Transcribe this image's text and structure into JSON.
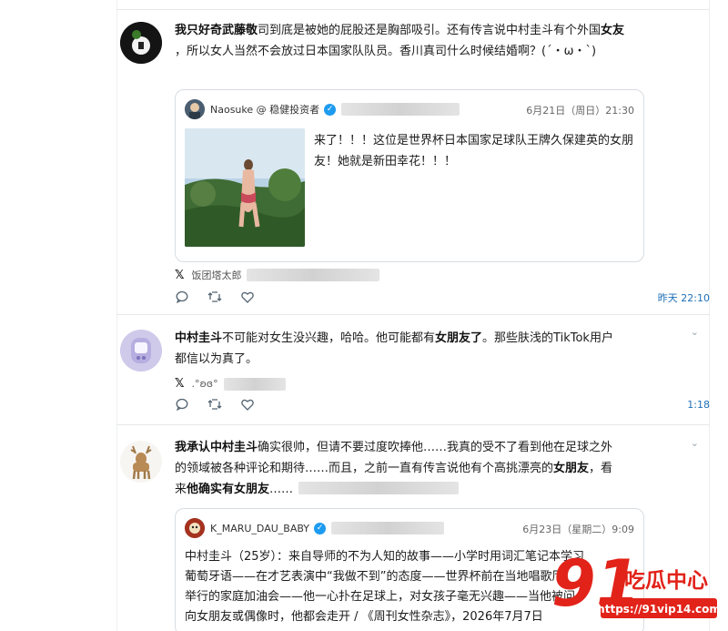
{
  "posts": [
    {
      "author": "我只好奇武藤敬",
      "text_before": "司到底是被她的屁股还是胸部吸引。还有传言说中村圭斗有个外国",
      "bold_tail": "女友",
      "line2": "，所以女人当然不会放过日本国家队队员。香川真司什么时候结婚啊？(´・ω・`)",
      "quote": {
        "author": "Naosuke @ 稳健投资者",
        "date": "6月21日（周日）21:30",
        "text": "来了！！！这位是世界杯日本国家足球队王牌久保建英的女朋友！她就是新田幸花！！！"
      },
      "source_name": "饭团塔太郎",
      "time": "昨天 22:10"
    },
    {
      "author": "中村圭斗",
      "text_a": "不可能对女生没兴趣，哈哈。他可能都有",
      "bold_b": "女朋友了",
      "text_c": "。那些肤浅的TikTok用户",
      "line2": "都信以为真了。",
      "source_name": ".°ʚɞ°",
      "time": "1:18"
    },
    {
      "author": "我承认中村圭斗",
      "text_a": "确实很帅，但请不要过度吹捧他……我真的受不了看到他在足球之外",
      "line2_a": "的领域被各种评论和期待……而且，之前一直有传言说他有个高挑漂亮的",
      "bold_line2": "女朋友",
      "line2_b": "，看",
      "line3_a": "来",
      "bold_line3": "他确实有女朋友",
      "line3_b": "……",
      "quote": {
        "author": "K_MARU_DAU_BABY",
        "date": "6月23日（星期二）9:09",
        "line1": "中村圭斗（25岁）：来自导师的不为人知的故事——小学时用词汇笔记本学习",
        "line2": "葡萄牙语——在才艺表演中“我做不到”的态度——世界杯前在当地唱歌厅",
        "line3": "举行的家庭加油会——他一心扑在足球上，对女孩子毫无兴趣——当他被问",
        "line4": "向女朋友或偶像时，他都会走开 / 《周刊女性杂志》，2026年7月7日"
      },
      "source_name": ""
    }
  ],
  "watermark": {
    "number": "91",
    "brand": "吃瓜中心",
    "url": "https://91vip14.com"
  },
  "colors": {
    "verified": "#1d9bf0",
    "time_link": "#1d6fb8",
    "watermark_red": "#e2231a"
  },
  "icons": [
    "x-logo-icon",
    "reply-icon",
    "repost-icon",
    "like-icon",
    "verified-icon",
    "chevron-down-icon"
  ]
}
